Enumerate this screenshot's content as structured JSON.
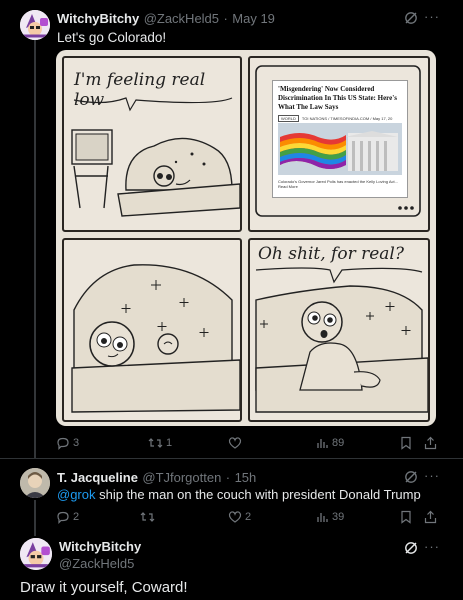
{
  "tweet1": {
    "name": "WitchyBitchy",
    "handle": "@ZackHeld5",
    "date": "May 19",
    "separator": "·",
    "text": "Let's go Colorado!",
    "actions": {
      "replies": "3",
      "reposts": "1",
      "likes": "",
      "views": "89"
    }
  },
  "comic": {
    "panel1_text": "I'm feeling real low",
    "panel4_text": "Oh shit, for real?",
    "article": {
      "headline": "'Misgendering' Now Considered Discrimination In This US State: Here's What The Law Says",
      "tag": "WORLD",
      "source": "TOI NATIONS / TIMESOFINDIA.COM / May 17, 20",
      "caption": "Colorado's Governor Jared Polis has enacted the Kelly Loving Act... Read More"
    }
  },
  "tweet2": {
    "name": "T. Jacqueline",
    "handle": "@TJforgotten",
    "date": "15h",
    "separator": "·",
    "mention": "@grok",
    "text": " ship the man on the couch with president Donald Trump",
    "actions": {
      "replies": "2",
      "reposts": "",
      "likes": "2",
      "views": "39"
    }
  },
  "tweet3": {
    "name": "WitchyBitchy",
    "handle": "@ZackHeld5",
    "text": "Draw it yourself, Coward!"
  },
  "colors": {
    "background": "#000000",
    "text": "#e7e9ea",
    "muted": "#71767b",
    "link": "#1d9bf0",
    "divider": "#2f3336"
  }
}
